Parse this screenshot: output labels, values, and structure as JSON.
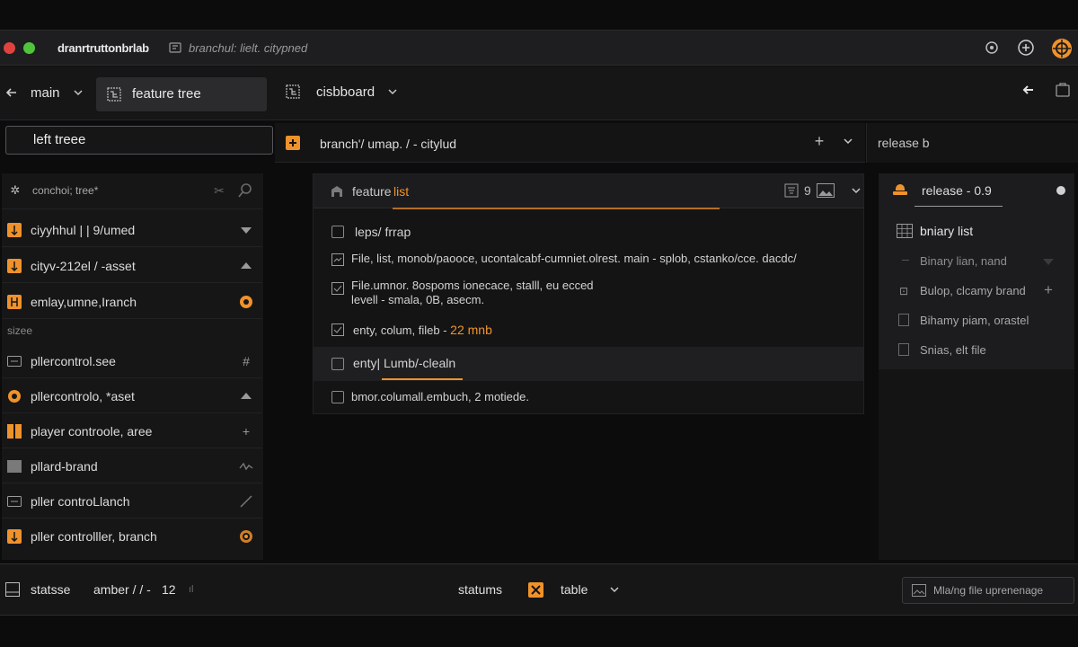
{
  "titlebar": {
    "app_name": "dranrtruttonbrlab",
    "path": "branchul: lielt. citypned"
  },
  "toolbar": {
    "branch": "main",
    "tab_feature": "feature tree",
    "tab_dashboard": "cisbboard"
  },
  "left": {
    "field_value": "left treee",
    "panel_title": "conchoi; tree*",
    "section_label": "sizee",
    "items": [
      {
        "label": "ciyyhhul | | 9/umed"
      },
      {
        "label": "cityv-212el / -asset"
      },
      {
        "label": "emlay,umne,Iranch"
      },
      {
        "label": "pllercontrol.see"
      },
      {
        "label": "pllercontrolo, *aset"
      },
      {
        "label": "player controole, aree"
      },
      {
        "label": "pllard-brand"
      },
      {
        "label": "pller controLlanch"
      },
      {
        "label": "pller controlller, branch"
      }
    ]
  },
  "center": {
    "breadcrumb": "branch'/ umap. / - citylud",
    "card_title_a": "feature",
    "card_title_b": "list",
    "card_count": "9",
    "rows": [
      {
        "text": "leps/ frrap"
      },
      {
        "text": "File, list, monob/paooce, ucontalcabf-cumniet.olrest. main - splob, cstanko/cce. dacdc/"
      },
      {
        "text": "File.umnor. 8ospoms ionecace, stalll, eu ecced"
      },
      {
        "text": "levell - smala, 0B, asecm."
      },
      {
        "text": "enty, colum, fileb -",
        "highlight": "22 mnb"
      },
      {
        "text": "enty| Lumb/-clealn"
      },
      {
        "text": "bmor.columall.embuch, 2 motiede."
      }
    ]
  },
  "right": {
    "header": "release b",
    "panel_title": "release - 0.9",
    "list_title": "bniary list",
    "items": [
      {
        "label": "Binary  lian,  nand"
      },
      {
        "label": "Bulop, clcamy brand"
      },
      {
        "label": "Bihamy piam, orastel"
      },
      {
        "label": "Snias, elt file"
      }
    ]
  },
  "status": {
    "left_label": "statsse",
    "middle_label": "amber / / -",
    "count": "12",
    "statums": "statums",
    "table_label": "table",
    "search_placeholder": "Mla/ng file uprenenage"
  }
}
